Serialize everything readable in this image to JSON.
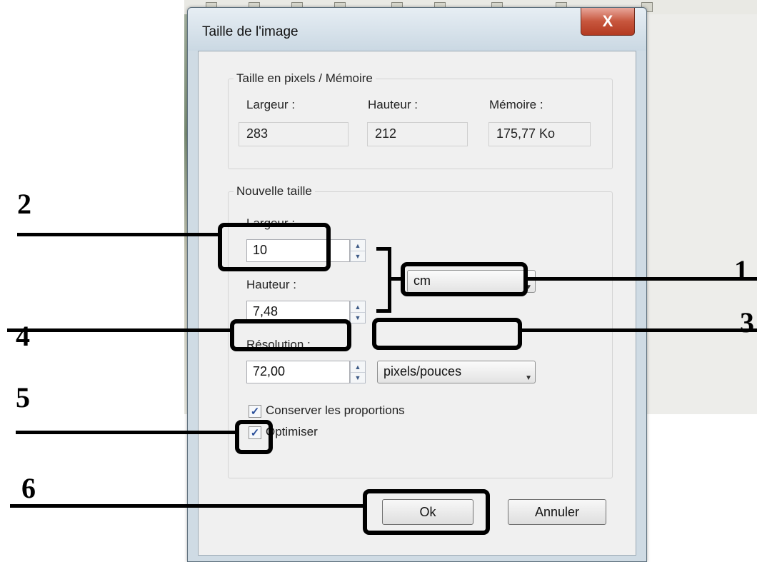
{
  "dialog": {
    "title": "Taille de l'image",
    "close_symbol": "X"
  },
  "pixel_memory": {
    "legend": "Taille en pixels / Mémoire",
    "width_label": "Largeur :",
    "width_value": "283",
    "height_label": "Hauteur :",
    "height_value": "212",
    "memory_label": "Mémoire :",
    "memory_value": "175,77 Ko"
  },
  "new_size": {
    "legend": "Nouvelle taille",
    "width_label": "Largeur :",
    "width_value": "10",
    "height_label": "Hauteur :",
    "height_value": "7,48",
    "unit_selected": "cm",
    "resolution_label": "Résolution :",
    "resolution_value": "72,00",
    "resolution_unit_selected": "pixels/pouces",
    "keep_proportions_label": "Conserver les proportions",
    "keep_proportions_checked": true,
    "optimize_label": "Optimiser",
    "optimize_checked": true
  },
  "buttons": {
    "ok": "Ok",
    "cancel": "Annuler"
  },
  "annotations": [
    "1",
    "2",
    "3",
    "4",
    "5",
    "6"
  ],
  "colors": {
    "window_frame": "#cfdbe4",
    "client_bg": "#f0f0f0",
    "close_button": "#c7563d",
    "checkbox_mark": "#2a4f9a",
    "annotation": "#000000"
  }
}
